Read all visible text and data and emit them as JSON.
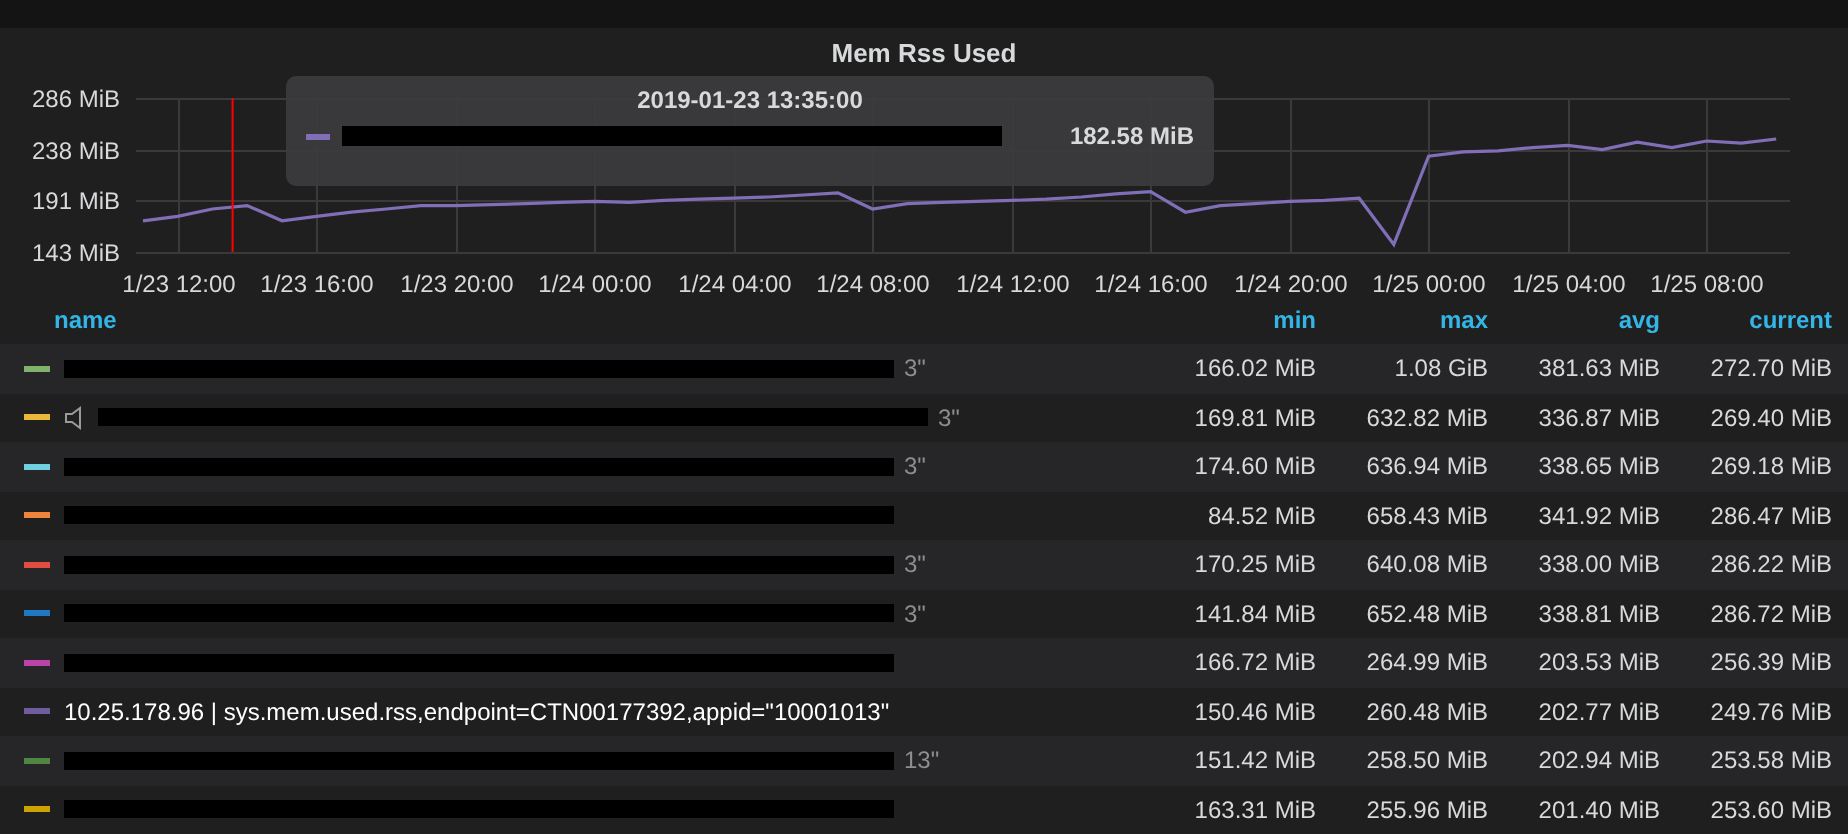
{
  "panel": {
    "title": "Mem Rss Used"
  },
  "graph": {
    "chart_data": {
      "type": "line",
      "yticks": [
        {
          "value": 143,
          "label": "143 MiB"
        },
        {
          "value": 191,
          "label": "191 MiB"
        },
        {
          "value": 238,
          "label": "238 MiB"
        },
        {
          "value": 286,
          "label": "286 MiB"
        }
      ],
      "ylim": [
        143,
        286
      ],
      "categories": [
        null,
        "1/23 12:00",
        null,
        null,
        null,
        "1/23 16:00",
        null,
        null,
        null,
        "1/23 20:00",
        null,
        null,
        null,
        "1/24 00:00",
        null,
        null,
        null,
        "1/24 04:00",
        null,
        null,
        null,
        "1/24 08:00",
        null,
        null,
        null,
        "1/24 12:00",
        null,
        null,
        null,
        "1/24 16:00",
        null,
        null,
        null,
        "1/24 20:00",
        null,
        null,
        null,
        "1/25 00:00",
        null,
        null,
        null,
        "1/25 04:00",
        null,
        null,
        null,
        "1/25 08:00",
        null,
        null
      ],
      "series": [
        {
          "color": "#806eb7",
          "values": [
            172,
            176,
            183,
            186,
            172,
            176,
            180,
            183,
            186,
            186,
            187,
            188,
            189,
            190,
            189,
            191,
            192,
            193,
            194,
            196,
            198,
            183,
            188,
            189,
            190,
            191,
            192,
            194,
            197,
            199,
            180,
            186,
            188,
            190,
            191,
            193,
            150,
            232,
            236,
            237,
            240,
            242,
            238,
            245,
            240,
            246,
            244,
            248
          ]
        }
      ],
      "grid": true
    },
    "tooltip": {
      "time": "2019-01-23 13:35:00",
      "color": "#806eb7",
      "value": "182.58 MiB"
    }
  },
  "legend": {
    "columns": [
      "name",
      "min",
      "max",
      "avg",
      "current"
    ],
    "rows": [
      {
        "color": "#7eb26d",
        "kind": "redacted",
        "tail": "3\"",
        "min": "166.02 MiB",
        "max": "1.08 GiB",
        "avg": "381.63 MiB",
        "current": "272.70 MiB"
      },
      {
        "color": "#eab839",
        "kind": "redacted_icon",
        "tail": "3\"",
        "min": "169.81 MiB",
        "max": "632.82 MiB",
        "avg": "336.87 MiB",
        "current": "269.40 MiB"
      },
      {
        "color": "#6ed0e0",
        "kind": "redacted",
        "tail": "3\"",
        "min": "174.60 MiB",
        "max": "636.94 MiB",
        "avg": "338.65 MiB",
        "current": "269.18 MiB"
      },
      {
        "color": "#ef843c",
        "kind": "redacted",
        "min": "84.52 MiB",
        "max": "658.43 MiB",
        "avg": "341.92 MiB",
        "current": "286.47 MiB"
      },
      {
        "color": "#e24d42",
        "kind": "redacted",
        "tail": "3\"",
        "min": "170.25 MiB",
        "max": "640.08 MiB",
        "avg": "338.00 MiB",
        "current": "286.22 MiB"
      },
      {
        "color": "#1f78c1",
        "kind": "redacted",
        "tail": "3\"",
        "min": "141.84 MiB",
        "max": "652.48 MiB",
        "avg": "338.81 MiB",
        "current": "286.72 MiB"
      },
      {
        "color": "#ba43a9",
        "kind": "redacted",
        "min": "166.72 MiB",
        "max": "264.99 MiB",
        "avg": "203.53 MiB",
        "current": "256.39 MiB"
      },
      {
        "color": "#705da0",
        "kind": "named",
        "name": "10.25.178.96 | sys.mem.used.rss,endpoint=CTN00177392,appid=\"10001013\"",
        "min": "150.46 MiB",
        "max": "260.48 MiB",
        "avg": "202.77 MiB",
        "current": "249.76 MiB"
      },
      {
        "color": "#508642",
        "kind": "redacted",
        "tail": "13\"",
        "min": "151.42 MiB",
        "max": "258.50 MiB",
        "avg": "202.94 MiB",
        "current": "253.58 MiB"
      },
      {
        "color": "#cca300",
        "kind": "redacted",
        "min": "163.31 MiB",
        "max": "255.96 MiB",
        "avg": "201.40 MiB",
        "current": "253.60 MiB"
      }
    ]
  }
}
